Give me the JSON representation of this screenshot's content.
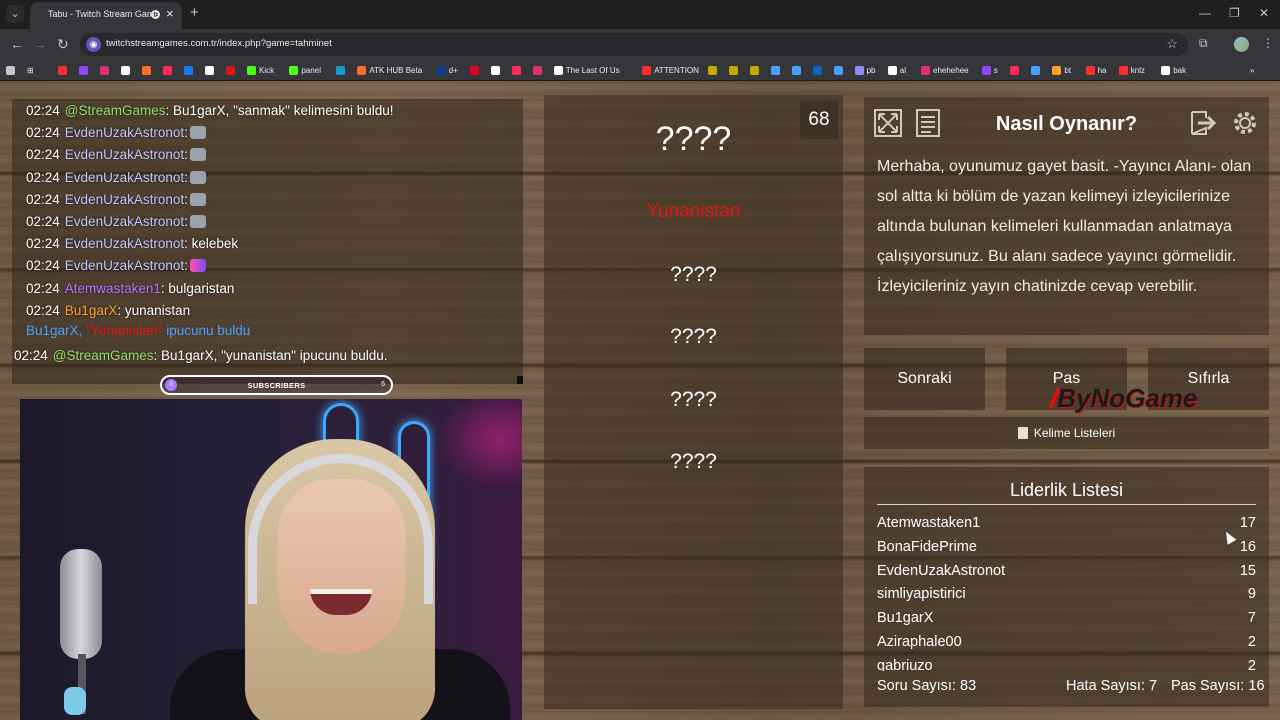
{
  "browser": {
    "tab_title": "Tabu - Twitch Stream Games",
    "url": "twitchstreamgames.com.tr/index.php?game=tahminet",
    "bookmarks": [
      {
        "label": "",
        "color": "#ff2d2d"
      },
      {
        "label": "",
        "color": "#9146ff"
      },
      {
        "label": "",
        "color": "#e1306c"
      },
      {
        "label": "",
        "color": "#ffffff"
      },
      {
        "label": "",
        "color": "#ff6b2b"
      },
      {
        "label": "",
        "color": "#ff2d55"
      },
      {
        "label": "",
        "color": "#1877f2"
      },
      {
        "label": "",
        "color": "#ffffff"
      },
      {
        "label": "",
        "color": "#e01616"
      },
      {
        "label": "Kick",
        "color": "#53fc18"
      },
      {
        "label": "panel",
        "color": "#53fc18"
      },
      {
        "label": "",
        "color": "#1b9bd1"
      },
      {
        "label": "ATK HUB Beta",
        "color": "#ff6b2b"
      },
      {
        "label": "d+",
        "color": "#0f3a8c"
      },
      {
        "label": "",
        "color": "#e60023"
      },
      {
        "label": "",
        "color": "#ffffff"
      },
      {
        "label": "",
        "color": "#ff2d55"
      },
      {
        "label": "",
        "color": "#e1306c"
      },
      {
        "label": "The Last Of Us",
        "color": "#ffffff"
      },
      {
        "label": "ATTENTION",
        "color": "#ff2d2d"
      },
      {
        "label": "",
        "color": "#c8a800"
      },
      {
        "label": "",
        "color": "#c8a800"
      },
      {
        "label": "",
        "color": "#c8a800"
      },
      {
        "label": "",
        "color": "#4aa0ff"
      },
      {
        "label": "",
        "color": "#4aa0ff"
      },
      {
        "label": "",
        "color": "#0a66c2"
      },
      {
        "label": "",
        "color": "#4aa0ff"
      },
      {
        "label": "pb",
        "color": "#8c8cff"
      },
      {
        "label": "al",
        "color": "#ffffff"
      },
      {
        "label": "ehehehee",
        "color": "#e1306c"
      },
      {
        "label": "s",
        "color": "#9146ff"
      },
      {
        "label": "",
        "color": "#ff2d55"
      },
      {
        "label": "",
        "color": "#4aa0ff"
      },
      {
        "label": "bt",
        "color": "#ff9f2e"
      },
      {
        "label": "ha",
        "color": "#ff2d2d"
      },
      {
        "label": "knlz",
        "color": "#ff2d2d"
      },
      {
        "label": "bak",
        "color": "#ffffff"
      }
    ]
  },
  "chat": {
    "messages": [
      {
        "time": "02:24",
        "user": "@StreamGames",
        "user_color": "green",
        "sep": ":",
        "text": " Bu1garX, \"sanmak\" kelimesini buldu!",
        "emote": ""
      },
      {
        "time": "02:24",
        "user": "EvdenUzakAstronot",
        "user_color": "blue",
        "sep": ":",
        "text": "",
        "emote": "gray"
      },
      {
        "time": "02:24",
        "user": "EvdenUzakAstronot",
        "user_color": "blue",
        "sep": ":",
        "text": "",
        "emote": "gray"
      },
      {
        "time": "02:24",
        "user": "EvdenUzakAstronot",
        "user_color": "blue",
        "sep": ":",
        "text": "",
        "emote": "gray"
      },
      {
        "time": "02:24",
        "user": "EvdenUzakAstronot",
        "user_color": "blue",
        "sep": ":",
        "text": "",
        "emote": "gray"
      },
      {
        "time": "02:24",
        "user": "EvdenUzakAstronot",
        "user_color": "blue",
        "sep": ":",
        "text": "",
        "emote": "gray"
      },
      {
        "time": "02:24",
        "user": "EvdenUzakAstronot",
        "user_color": "blue",
        "sep": ":",
        "text": " kelebek",
        "emote": ""
      },
      {
        "time": "02:24",
        "user": "EvdenUzakAstronot",
        "user_color": "blue",
        "sep": ":",
        "text": "",
        "emote": "pink"
      },
      {
        "time": "02:24",
        "user": "Atemwastaken1",
        "user_color": "purple",
        "sep": ":",
        "text": " bulgaristan",
        "emote": ""
      },
      {
        "time": "02:24",
        "user": "Bu1garX",
        "user_color": "orange",
        "sep": ":",
        "text": " yunanistan",
        "emote": ""
      }
    ],
    "hint": {
      "user": "Bu1garX,",
      "word": "\"Yunanistan\"",
      "rest": "ipucunu buldu"
    },
    "last": {
      "time": "02:24",
      "user": "@StreamGames",
      "sep": ":",
      "text": " Bu1garX, \"yunanistan\" ipucunu buldu."
    }
  },
  "subscribers": {
    "label": "SUBSCRIBERS",
    "current": "0",
    "goal": "6"
  },
  "card": {
    "counter": "68",
    "main_word": "????",
    "found_word": "Yunanistan",
    "hidden": [
      "????",
      "????",
      "????",
      "????"
    ]
  },
  "help": {
    "title": "Nasıl Oynanır?",
    "text": "Merhaba, oyunumuz gayet basit. -Yayıncı Alanı- olan sol altta ki bölüm de yazan kelimeyi izleyicilerinize altında bulunan kelimeleri kullanmadan anlatmaya çalışıyorsunuz. Bu alanı sadece yayıncı görmelidir. İzleyicileriniz yayın chatinizde cevap verebilir."
  },
  "buttons": {
    "next": "Sonraki",
    "pass": "Pas",
    "reset": "Sıfırla",
    "word_lists": "Kelime Listeleri"
  },
  "watermark": "ByNoGame",
  "leaderboard": {
    "title": "Liderlik Listesi",
    "rows": [
      {
        "name": "Atemwastaken1",
        "score": "17"
      },
      {
        "name": "BonaFidePrime",
        "score": "16"
      },
      {
        "name": "EvdenUzakAstronot",
        "score": "15"
      },
      {
        "name": "simliyapistirici",
        "score": "9"
      },
      {
        "name": "Bu1garX",
        "score": "7"
      },
      {
        "name": "Aziraphale00",
        "score": "2"
      },
      {
        "name": "gabriuzo",
        "score": "2"
      }
    ]
  },
  "stats": {
    "questions_label": "Soru Sayısı:",
    "questions": "83",
    "errors_label": "Hata Sayısı:",
    "errors": "7",
    "passes_label": "Pas Sayısı:",
    "passes": "16"
  }
}
